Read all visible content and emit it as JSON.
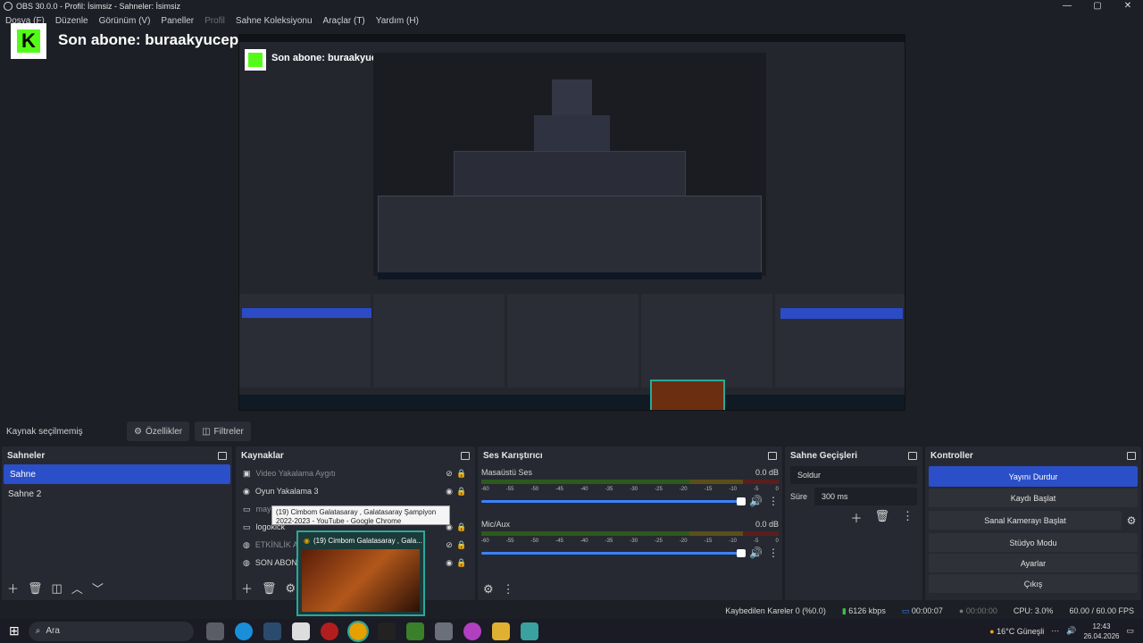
{
  "window": {
    "title": "OBS 30.0.0 - Profil: İsimsiz - Sahneler: İsimsiz",
    "controls": [
      "—",
      "▢",
      "✕"
    ]
  },
  "menu": [
    "Dosya (F)",
    "Düzenle",
    "Görünüm (V)",
    "Paneller",
    "Profil",
    "Sahne Koleksiyonu",
    "Araçlar (T)",
    "Yardım (H)"
  ],
  "overlay": {
    "logo_letter": "K",
    "subscriber_text": "Son abone: buraakyucepur"
  },
  "source_bar": {
    "label": "Kaynak seçilmemiş",
    "properties": "Özellikler",
    "filters": "Filtreler"
  },
  "scenes": {
    "title": "Sahneler",
    "items": [
      "Sahne",
      "Sahne 2"
    ]
  },
  "sources": {
    "title": "Kaynaklar",
    "items": [
      {
        "name": "Video Yakalama Aygıtı",
        "dim": true
      },
      {
        "name": "Oyun Yakalama 3",
        "dim": false
      },
      {
        "name": "may",
        "dim": true
      },
      {
        "name": "logokick",
        "dim": false
      },
      {
        "name": "ETKİNLİK A",
        "dim": true
      },
      {
        "name": "SON ABONE",
        "dim": false
      }
    ]
  },
  "mixer": {
    "title": "Ses Karıştırıcı",
    "channels": [
      {
        "name": "Masaüstü Ses",
        "db": "0.0 dB"
      },
      {
        "name": "Mic/Aux",
        "db": "0.0 dB"
      }
    ],
    "ticks": [
      "-60",
      "-55",
      "-50",
      "-45",
      "-40",
      "-35",
      "-30",
      "-25",
      "-20",
      "-15",
      "-10",
      "-5",
      "0"
    ]
  },
  "transitions": {
    "title": "Sahne Geçişleri",
    "selected": "Soldur",
    "duration_label": "Süre",
    "duration": "300 ms"
  },
  "controls": {
    "title": "Kontroller",
    "buttons": [
      "Yayını Durdur",
      "Kaydı Başlat",
      "Sanal Kamerayı Başlat",
      "Stüdyo Modu",
      "Ayarlar",
      "Çıkış"
    ]
  },
  "status": {
    "dropped": "Kaybedilen Kareler 0 (%0.0)",
    "bitrate": "6126 kbps",
    "stream_time": "00:00:07",
    "rec_time": "00:00:00",
    "cpu": "CPU: 3.0%",
    "fps": "60.00 / 60.00 FPS"
  },
  "tooltip": {
    "text": "(19) Cimbom Galatasaray , Galatasaray Şampiyon 2022-2023 - YouTube - Google Chrome"
  },
  "preview_thumb": {
    "title": "(19) Cimbom Galatasaray , Gala..."
  },
  "taskbar": {
    "search": "Ara",
    "weather": "16°C  Güneşli",
    "time": "12:43",
    "date": "26.04.2026"
  }
}
